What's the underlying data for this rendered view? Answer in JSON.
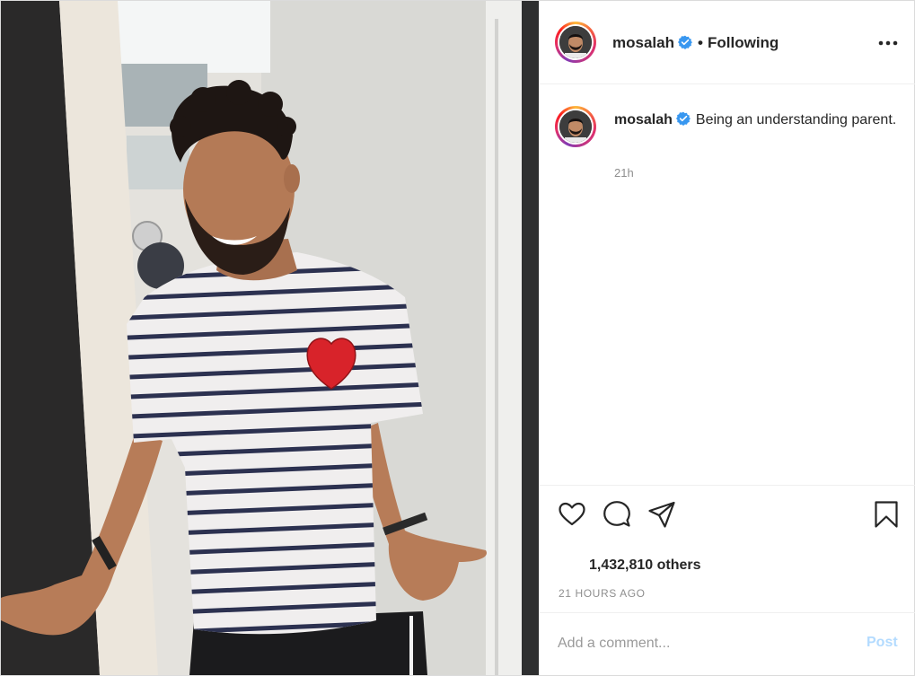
{
  "post": {
    "username": "mosalah",
    "verified": true,
    "separator": "•",
    "follow_status": "Following",
    "more_icon": "more-horizontal-icon",
    "caption": "Being an understanding parent.",
    "caption_time": "21h",
    "likes_text": "1,432,810 others",
    "time_ago": "21 HOURS AGO",
    "comment_placeholder": "Add a comment...",
    "post_label": "Post"
  },
  "icons": {
    "like": "heart-icon",
    "comment": "comment-icon",
    "share": "paper-plane-icon",
    "save": "bookmark-icon",
    "verified": "verified-badge-icon"
  },
  "colors": {
    "text": "#262626",
    "secondary": "#8e8e8e",
    "verified_blue": "#3897f0",
    "post_disabled": "#b3dbff",
    "border": "#efefef"
  }
}
